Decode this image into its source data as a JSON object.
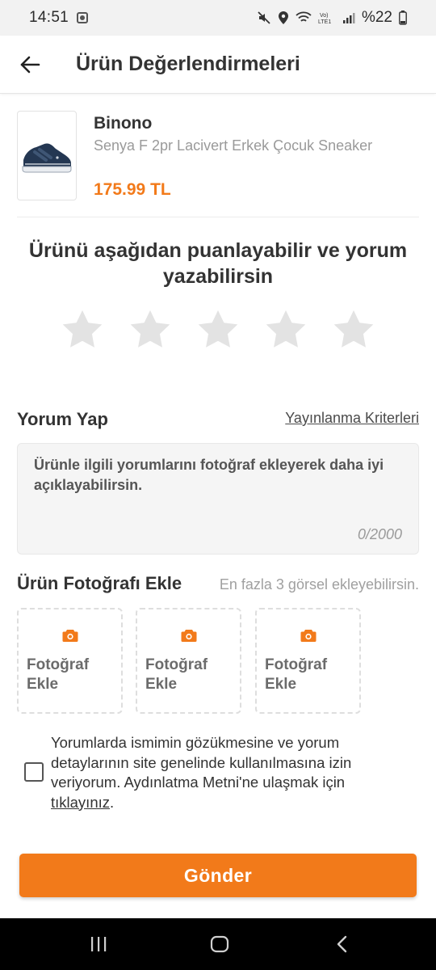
{
  "status_bar": {
    "time": "14:51",
    "battery": "%22",
    "icons": [
      "photo-app-icon",
      "mute-icon",
      "location-icon",
      "wifi-icon",
      "volte-icon",
      "signal-icon",
      "battery-icon"
    ]
  },
  "header": {
    "title": "Ürün Değerlendirmeleri",
    "back_icon": "arrow-left-icon"
  },
  "product": {
    "brand": "Binono",
    "name": "Senya F 2pr Lacivert Erkek Çocuk Sneaker",
    "price": "175.99 TL",
    "image_icon": "sneaker-image"
  },
  "rating": {
    "prompt": "Ürünü aşağıdan puanlayabilir ve yorum yazabilirsin",
    "max_stars": 5,
    "selected_stars": 0
  },
  "review": {
    "title": "Yorum Yap",
    "criteria_link": "Yayınlanma Kriterleri",
    "placeholder": "Ürünle ilgili yorumlarını fotoğraf ekleyerek daha iyi açıklayabilirsin.",
    "value": "",
    "char_count": "0/2000"
  },
  "photos": {
    "title": "Ürün Fotoğrafı Ekle",
    "hint": "En fazla 3 görsel ekleyebilirsin.",
    "slots": [
      {
        "label": "Fotoğraf Ekle"
      },
      {
        "label": "Fotoğraf Ekle"
      },
      {
        "label": "Fotoğraf Ekle"
      }
    ]
  },
  "consent": {
    "checked": false,
    "text": "Yorumlarda ismimin gözükmesine ve yorum detaylarının site genelinde kullanılmasına izin veriyorum. Aydınlatma Metni'ne ulaşmak için ",
    "link": "tıklayınız",
    "suffix": "."
  },
  "submit": {
    "label": "Gönder"
  },
  "colors": {
    "accent": "#f27a1a",
    "star_empty": "#e3e3e3"
  }
}
